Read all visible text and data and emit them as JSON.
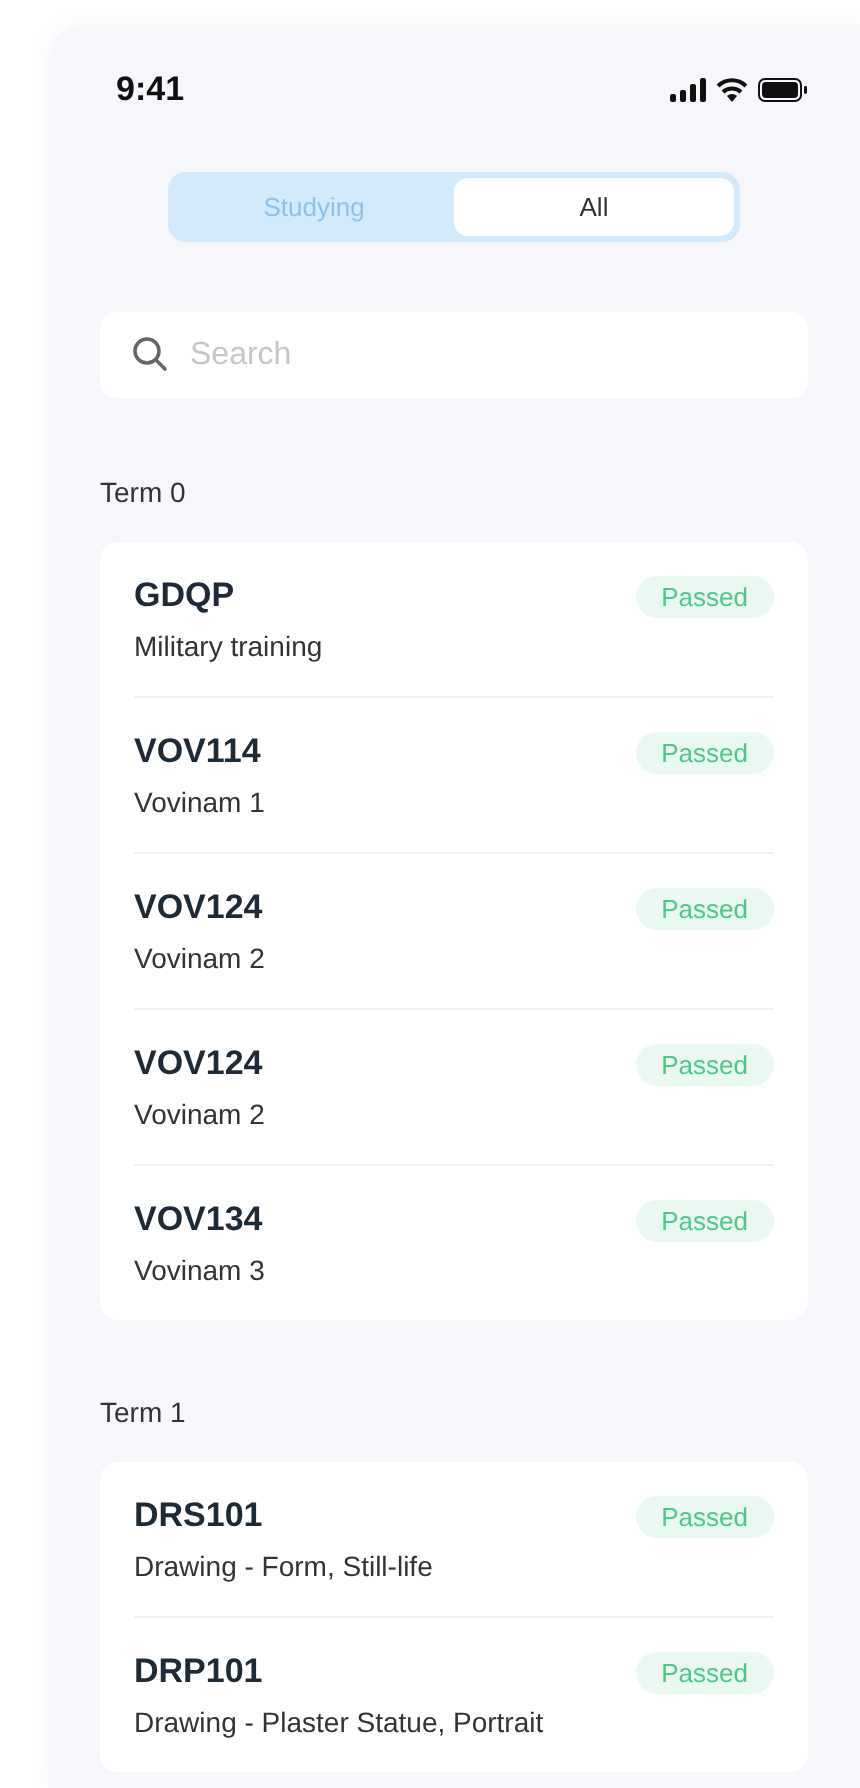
{
  "status_bar": {
    "time": "9:41"
  },
  "tabs": [
    {
      "label": "Studying",
      "selected": false
    },
    {
      "label": "All",
      "selected": true
    }
  ],
  "search": {
    "placeholder": "Search"
  },
  "terms": [
    {
      "title": "Term 0",
      "courses": [
        {
          "code": "GDQP",
          "name": "Military training",
          "status": "Passed",
          "kind": "passed"
        },
        {
          "code": "VOV114",
          "name": "Vovinam 1",
          "status": "Passed",
          "kind": "passed"
        },
        {
          "code": "VOV124",
          "name": "Vovinam 2",
          "status": "Passed",
          "kind": "passed"
        },
        {
          "code": "VOV124",
          "name": "Vovinam 2",
          "status": "Passed",
          "kind": "passed"
        },
        {
          "code": "VOV134",
          "name": "Vovinam 3",
          "status": "Passed",
          "kind": "passed"
        }
      ]
    },
    {
      "title": "Term 1",
      "courses": [
        {
          "code": "DRS101",
          "name": "Drawing - Form, Still-life",
          "status": "Passed",
          "kind": "passed"
        },
        {
          "code": "DRP101",
          "name": "Drawing - Plaster Statue, Portrait",
          "status": "Passed",
          "kind": "passed"
        }
      ]
    }
  ]
}
